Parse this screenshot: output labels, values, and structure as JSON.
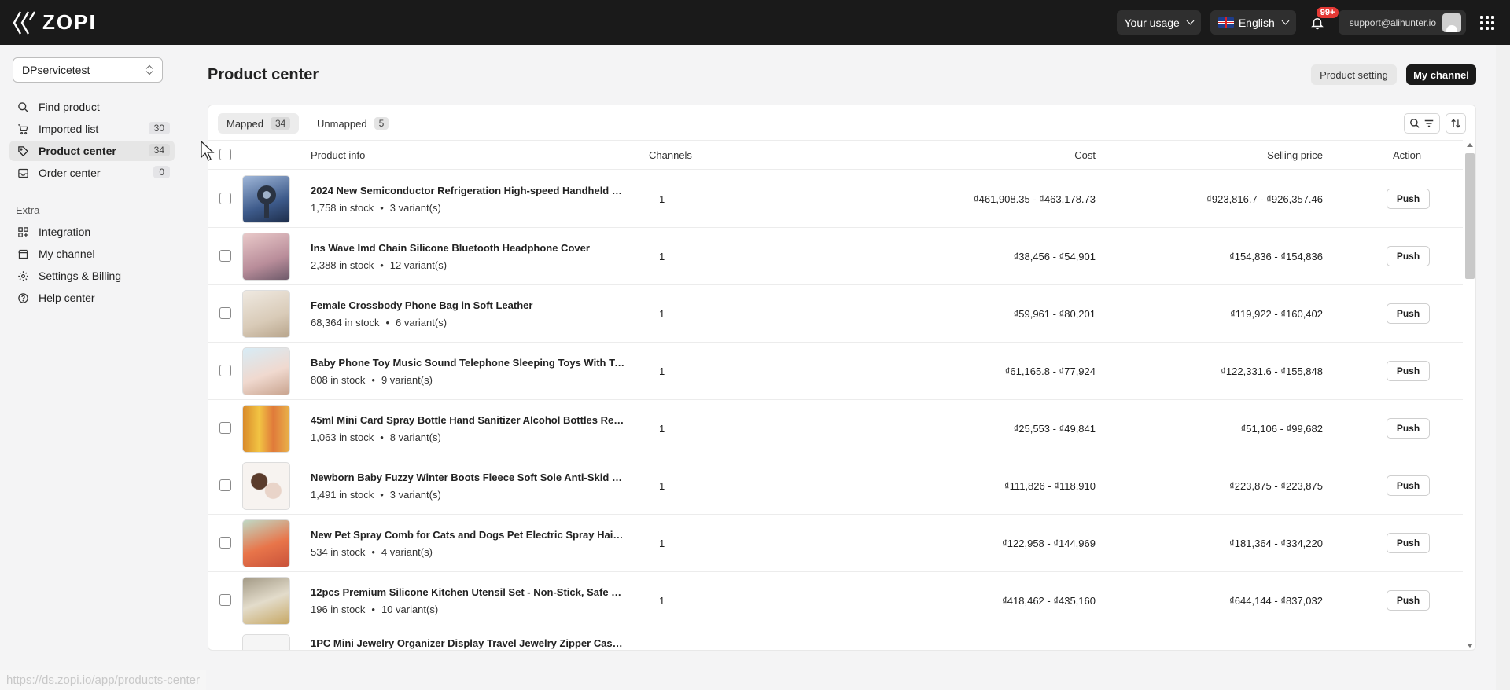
{
  "header": {
    "logo_text": "ZOPI",
    "usage_label": "Your usage",
    "language_label": "English",
    "notification_badge": "99+",
    "account_email": "support@alihunter.io"
  },
  "sidebar": {
    "store": "DPservicetest",
    "items": [
      {
        "label": "Find product",
        "icon": "search-icon"
      },
      {
        "label": "Imported list",
        "icon": "cart-icon",
        "count": "30"
      },
      {
        "label": "Product center",
        "icon": "tag-icon",
        "count": "34"
      },
      {
        "label": "Order center",
        "icon": "inbox-icon",
        "count": "0"
      }
    ],
    "extra_label": "Extra",
    "extra_items": [
      {
        "label": "Integration",
        "icon": "grid-plus-icon"
      },
      {
        "label": "My channel",
        "icon": "store-icon"
      },
      {
        "label": "Settings & Billing",
        "icon": "gear-icon"
      },
      {
        "label": "Help center",
        "icon": "help-icon"
      }
    ]
  },
  "page": {
    "title": "Product center",
    "product_setting_label": "Product setting",
    "my_channel_label": "My channel"
  },
  "tabs": [
    {
      "label": "Mapped",
      "count": "34"
    },
    {
      "label": "Unmapped",
      "count": "5"
    }
  ],
  "table": {
    "columns": {
      "product": "Product info",
      "channels": "Channels",
      "cost": "Cost",
      "selling": "Selling price",
      "action": "Action"
    },
    "push_label": "Push",
    "rows": [
      {
        "title": "2024 New Semiconductor Refrigeration High-speed Handheld Fan",
        "stock": "1,758 in stock",
        "variants": "3 variant(s)",
        "channels": "1",
        "cost": "₫461,908.35 - ₫463,178.73",
        "selling": "₫923,816.7 - ₫926,357.46"
      },
      {
        "title": "Ins Wave Imd Chain Silicone Bluetooth Headphone Cover",
        "stock": "2,388 in stock",
        "variants": "12 variant(s)",
        "channels": "1",
        "cost": "₫38,456 - ₫54,901",
        "selling": "₫154,836 - ₫154,836"
      },
      {
        "title": "Female Crossbody Phone Bag in Soft Leather",
        "stock": "68,364 in stock",
        "variants": "6 variant(s)",
        "channels": "1",
        "cost": "₫59,961 - ₫80,201",
        "selling": "₫119,922 - ₫160,402"
      },
      {
        "title": "Baby Phone Toy Music Sound Telephone Sleeping Toys With Teether",
        "stock": "808 in stock",
        "variants": "9 variant(s)",
        "channels": "1",
        "cost": "₫61,165.8 - ₫77,924",
        "selling": "₫122,331.6 - ₫155,848"
      },
      {
        "title": "45ml Mini Card Spray Bottle Hand Sanitizer Alcohol Bottles Refillable",
        "stock": "1,063 in stock",
        "variants": "8 variant(s)",
        "channels": "1",
        "cost": "₫25,553 - ₫49,841",
        "selling": "₫51,106 - ₫99,682"
      },
      {
        "title": "Newborn Baby Fuzzy Winter Boots Fleece Soft Sole Anti-Skid Shoes",
        "stock": "1,491 in stock",
        "variants": "3 variant(s)",
        "channels": "1",
        "cost": "₫111,826 - ₫118,910",
        "selling": "₫223,875 - ₫223,875"
      },
      {
        "title": "New Pet Spray Comb for Cats and Dogs Pet Electric Spray Hair Brush",
        "stock": "534 in stock",
        "variants": "4 variant(s)",
        "channels": "1",
        "cost": "₫122,958 - ₫144,969",
        "selling": "₫181,364 - ₫334,220"
      },
      {
        "title": "12pcs Premium Silicone Kitchen Utensil Set - Non-Stick, Safe Cooking",
        "stock": "196 in stock",
        "variants": "10 variant(s)",
        "channels": "1",
        "cost": "₫418,462 - ₫435,160",
        "selling": "₫644,144 - ₫837,032"
      },
      {
        "title": "1PC Mini Jewelry Organizer Display Travel Jewelry Zipper Case Box",
        "stock": "",
        "variants": "",
        "channels": "",
        "cost": "",
        "selling": ""
      }
    ]
  },
  "status_url": "https://ds.zopi.io/app/products-center"
}
